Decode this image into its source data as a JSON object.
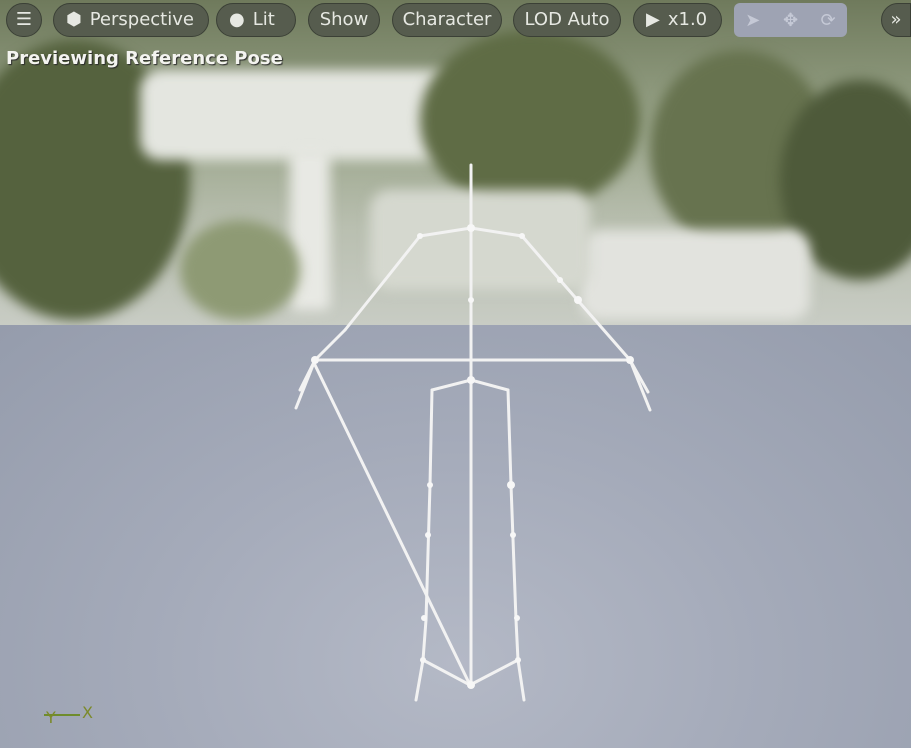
{
  "toolbar": {
    "menu_icon": "hamburger-icon",
    "perspective_label": "Perspective",
    "lit_label": "Lit",
    "show_label": "Show",
    "character_label": "Character",
    "lod_label": "LOD Auto",
    "playback_label": "x1.0",
    "transform_icons": [
      "select-arrow-icon",
      "move-icon",
      "rotate-icon"
    ],
    "overflow_icon": "chevron-double-right-icon"
  },
  "viewport": {
    "status_text": "Previewing Reference Pose"
  },
  "axis": {
    "x_label": "X",
    "y_label": "Y"
  },
  "colors": {
    "toolbar_button": "#565c4e",
    "floor": "#a3a9b8",
    "bone": "#f2f2f2"
  }
}
